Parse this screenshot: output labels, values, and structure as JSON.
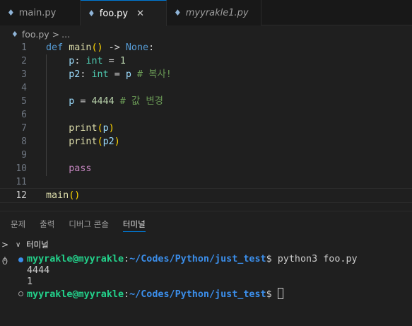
{
  "tabs": [
    {
      "label": "main.py",
      "icon": "python-icon"
    },
    {
      "label": "foo.py",
      "icon": "python-icon",
      "active": true,
      "close": "✕"
    },
    {
      "label": "myyrakle1.py",
      "icon": "python-icon"
    }
  ],
  "breadcrumb": {
    "file": "foo.py",
    "separator": ">",
    "more": "..."
  },
  "editor": {
    "line_numbers": [
      "1",
      "2",
      "3",
      "4",
      "5",
      "6",
      "7",
      "8",
      "9",
      "10",
      "11",
      "12"
    ],
    "lines": [
      {
        "kw": "def",
        "fn": "main",
        "paren": "()",
        "arrow": " -> ",
        "const": "None",
        "colon": ":"
      },
      {
        "var": "p",
        "colon": ": ",
        "type": "int",
        "eq": " = ",
        "num": "1"
      },
      {
        "var": "p2",
        "colon": ": ",
        "type": "int",
        "eq": " = ",
        "var2": "p",
        "cmt": " # 복사!"
      },
      {},
      {
        "var": "p",
        "eq": " = ",
        "num": "4444",
        "cmt": " # 값 변경"
      },
      {},
      {
        "fn": "print",
        "open": "(",
        "var": "p",
        "close": ")"
      },
      {
        "fn": "print",
        "open": "(",
        "var": "p2",
        "close": ")"
      },
      {},
      {
        "ctrl": "pass"
      },
      {},
      {
        "fn": "main",
        "paren": "()"
      }
    ]
  },
  "panel": {
    "tabs": [
      "문제",
      "출력",
      "디버그 콘솔",
      "터미널"
    ],
    "active_tab": "터미널",
    "terminal_title": "터미널"
  },
  "terminal": {
    "user_host": "myyrakle@myyrakle",
    "colon": ":",
    "path": "~/Codes/Python/just_test",
    "prompt_symbol": "$",
    "command": " python3 foo.py",
    "outputs": [
      "4444",
      "1"
    ]
  },
  "colors": {
    "accent": "#0078d4",
    "prompt_green": "#23d18b",
    "path_blue": "#3b8eea"
  }
}
